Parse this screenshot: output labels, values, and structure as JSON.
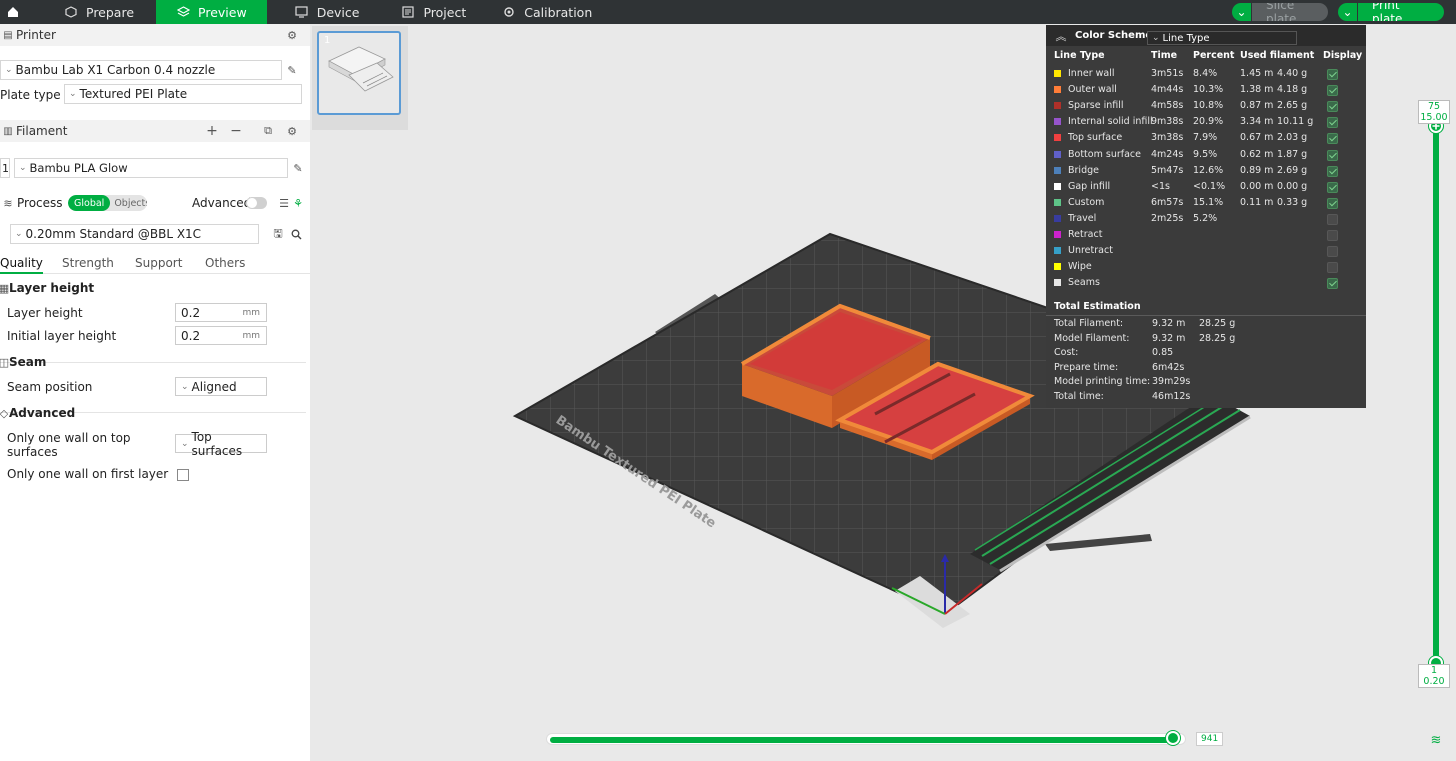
{
  "topbar": {
    "tabs": [
      {
        "label": "Prepare",
        "icon": "cube-icon"
      },
      {
        "label": "Preview",
        "icon": "layers-icon",
        "active": true
      },
      {
        "label": "Device",
        "icon": "monitor-icon"
      },
      {
        "label": "Project",
        "icon": "project-icon"
      },
      {
        "label": "Calibration",
        "icon": "calibration-icon"
      }
    ],
    "slice_label": "Slice plate",
    "print_label": "Print plate",
    "accent": "#00ae42"
  },
  "printer": {
    "section_label": "Printer",
    "printer_name": "Bambu Lab X1 Carbon 0.4 nozzle",
    "plate_type_label": "Plate type",
    "plate_type_value": "Textured PEI Plate"
  },
  "filament": {
    "section_label": "Filament",
    "slot_number": "1",
    "filament_name": "Bambu PLA Glow"
  },
  "process": {
    "section_label": "Process",
    "global_label": "Global",
    "objects_label": "Objects",
    "advanced_label": "Advanced",
    "preset": "0.20mm Standard @BBL X1C",
    "tabs": [
      "Quality",
      "Strength",
      "Support",
      "Others"
    ],
    "layer_height_group": "Layer height",
    "layer_height_label": "Layer height",
    "layer_height_value": "0.2",
    "initial_layer_height_label": "Initial layer height",
    "initial_layer_height_value": "0.2",
    "unit_mm": "mm",
    "seam_group": "Seam",
    "seam_position_label": "Seam position",
    "seam_position_value": "Aligned",
    "advanced_group": "Advanced",
    "one_wall_top_label_1": "Only one wall on top",
    "one_wall_top_label_2": "surfaces",
    "one_wall_top_value": "Top surfaces",
    "one_wall_first_label": "Only one wall on first layer"
  },
  "plate_thumbnail": {
    "number": "1"
  },
  "legend": {
    "color_scheme_label": "Color Scheme",
    "color_scheme_value": "Line Type",
    "headers": [
      "Line Type",
      "Time",
      "Percent",
      "Used filament",
      "Display"
    ],
    "rows": [
      {
        "name": "Inner wall",
        "color": "#ffe600",
        "time": "3m51s",
        "percent": "8.4%",
        "length": "1.45 m",
        "weight": "4.40 g",
        "display": true
      },
      {
        "name": "Outer wall",
        "color": "#ff7d38",
        "time": "4m44s",
        "percent": "10.3%",
        "length": "1.38 m",
        "weight": "4.18 g",
        "display": true
      },
      {
        "name": "Sparse infill",
        "color": "#b03029",
        "time": "4m58s",
        "percent": "10.8%",
        "length": "0.87 m",
        "weight": "2.65 g",
        "display": true
      },
      {
        "name": "Internal solid infill",
        "color": "#9654cc",
        "time": "9m38s",
        "percent": "20.9%",
        "length": "3.34 m",
        "weight": "10.11 g",
        "display": true
      },
      {
        "name": "Top surface",
        "color": "#f04040",
        "time": "3m38s",
        "percent": "7.9%",
        "length": "0.67 m",
        "weight": "2.03 g",
        "display": true
      },
      {
        "name": "Bottom surface",
        "color": "#6060c8",
        "time": "4m24s",
        "percent": "9.5%",
        "length": "0.62 m",
        "weight": "1.87 g",
        "display": true
      },
      {
        "name": "Bridge",
        "color": "#4d80ba",
        "time": "5m47s",
        "percent": "12.6%",
        "length": "0.89 m",
        "weight": "2.69 g",
        "display": true
      },
      {
        "name": "Gap infill",
        "color": "#ffffff",
        "time": "<1s",
        "percent": "<0.1%",
        "length": "0.00 m",
        "weight": "0.00 g",
        "display": true
      },
      {
        "name": "Custom",
        "color": "#5ec488",
        "time": "6m57s",
        "percent": "15.1%",
        "length": "0.11 m",
        "weight": "0.33 g",
        "display": true
      },
      {
        "name": "Travel",
        "color": "#383ca0",
        "time": "2m25s",
        "percent": "5.2%",
        "length": "",
        "weight": "",
        "display": false
      },
      {
        "name": "Retract",
        "color": "#cc22cc",
        "time": "",
        "percent": "",
        "length": "",
        "weight": "",
        "display": false
      },
      {
        "name": "Unretract",
        "color": "#36a0c8",
        "time": "",
        "percent": "",
        "length": "",
        "weight": "",
        "display": false
      },
      {
        "name": "Wipe",
        "color": "#ffff00",
        "time": "",
        "percent": "",
        "length": "",
        "weight": "",
        "display": false
      },
      {
        "name": "Seams",
        "color": "#e6e6e6",
        "time": "",
        "percent": "",
        "length": "",
        "weight": "",
        "display": true
      }
    ],
    "total_estimation_label": "Total Estimation",
    "totals": [
      {
        "label": "Total Filament:",
        "v1": "9.32 m",
        "v2": "28.25 g"
      },
      {
        "label": "Model Filament:",
        "v1": "9.32 m",
        "v2": "28.25 g"
      },
      {
        "label": "Cost:",
        "v1": "0.85",
        "v2": ""
      },
      {
        "label": "Prepare time:",
        "v1": "6m42s",
        "v2": ""
      },
      {
        "label": "Model printing time:",
        "v1": "39m29s",
        "v2": ""
      },
      {
        "label": "Total time:",
        "v1": "46m12s",
        "v2": ""
      }
    ]
  },
  "layer_slider": {
    "top_layer": "75",
    "top_height": "15.00",
    "bottom_layer": "1",
    "bottom_height": "0.20"
  },
  "move_slider": {
    "value": "941",
    "fraction": 1.0
  },
  "plate_label": "Bambu Textured PEI Plate"
}
